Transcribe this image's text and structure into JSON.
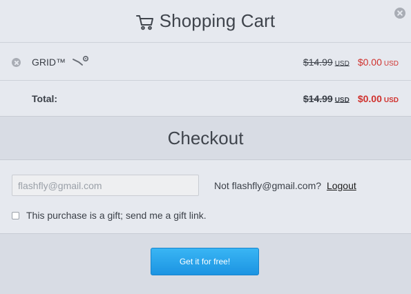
{
  "cart": {
    "title": "Shopping Cart",
    "close_icon": "close-icon"
  },
  "items": [
    {
      "name": "GRID™",
      "platform_icon": "steam-icon",
      "old_price": "$14.99",
      "old_currency": "USD",
      "new_price": "$0.00",
      "new_currency": "USD"
    }
  ],
  "total": {
    "label": "Total:",
    "old_price": "$14.99",
    "old_currency": "USD",
    "new_price": "$0.00",
    "new_currency": "USD"
  },
  "checkout": {
    "title": "Checkout",
    "email_placeholder": "flashfly@gmail.com",
    "not_user_text": "Not flashfly@gmail.com?",
    "logout_label": "Logout",
    "gift_label": "This purchase is a gift; send me a gift link.",
    "gift_checked": false
  },
  "footer": {
    "button_label": "Get it for free!"
  },
  "colors": {
    "accent_blue": "#1c94e2",
    "price_red": "#d0312d",
    "background": "#e6e9ef"
  }
}
